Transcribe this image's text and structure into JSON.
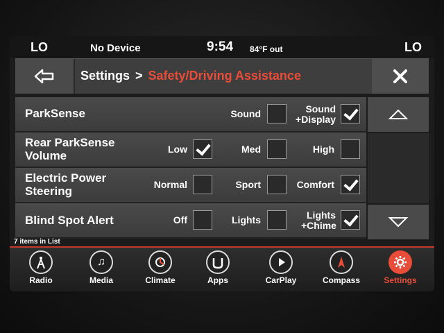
{
  "status": {
    "left_climate": "LO",
    "device": "No Device",
    "time": "9:54",
    "outside_temp": "84°F out",
    "right_climate": "LO"
  },
  "header": {
    "crumb_root": "Settings",
    "crumb_separator": ">",
    "crumb_current": "Safety/Driving Assistance"
  },
  "list": {
    "items_count": "7 items in List",
    "rows": [
      {
        "label": "ParkSense",
        "options": [
          {
            "label": "Sound",
            "checked": false
          },
          {
            "label": "Sound +Display",
            "checked": true
          }
        ]
      },
      {
        "label": "Rear ParkSense Volume",
        "options": [
          {
            "label": "Low",
            "checked": true
          },
          {
            "label": "Med",
            "checked": false
          },
          {
            "label": "High",
            "checked": false
          }
        ]
      },
      {
        "label": "Electric Power Steering",
        "options": [
          {
            "label": "Normal",
            "checked": false
          },
          {
            "label": "Sport",
            "checked": false
          },
          {
            "label": "Comfort",
            "checked": true
          }
        ]
      },
      {
        "label": "Blind Spot Alert",
        "options": [
          {
            "label": "Off",
            "checked": false
          },
          {
            "label": "Lights",
            "checked": false
          },
          {
            "label": "Lights +Chime",
            "checked": true
          }
        ]
      }
    ]
  },
  "dock": {
    "items": [
      {
        "label": "Radio",
        "icon": "radio-tower-icon"
      },
      {
        "label": "Media",
        "icon": "music-note-icon"
      },
      {
        "label": "Climate",
        "icon": "climate-fan-icon"
      },
      {
        "label": "Apps",
        "icon": "apps-icon"
      },
      {
        "label": "CarPlay",
        "icon": "carplay-icon"
      },
      {
        "label": "Compass",
        "icon": "compass-icon"
      },
      {
        "label": "Settings",
        "icon": "gear-icon"
      }
    ]
  },
  "colors": {
    "accent": "#e84d3a"
  }
}
